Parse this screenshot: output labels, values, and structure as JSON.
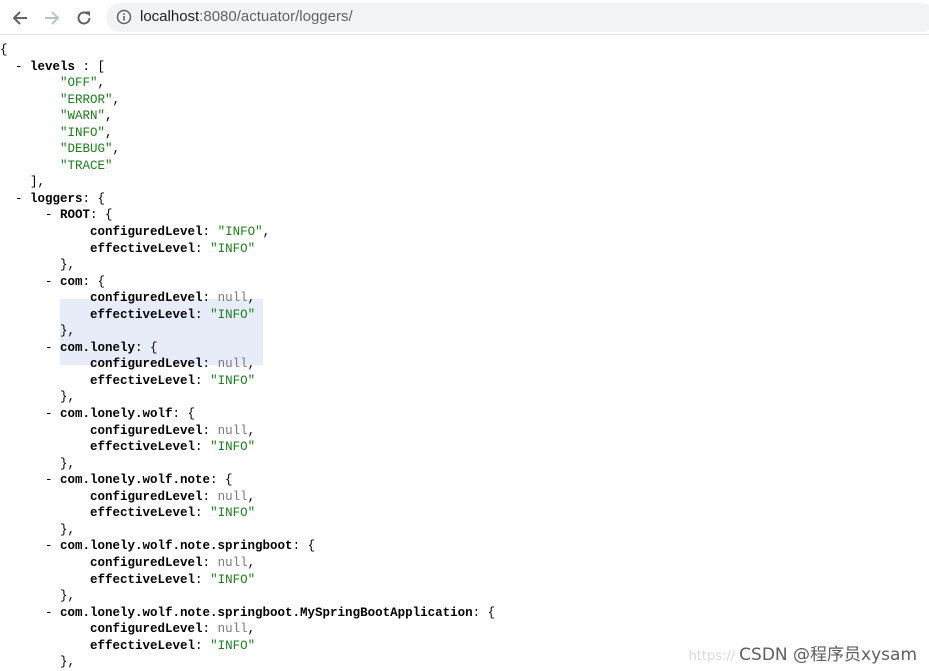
{
  "browser": {
    "url_host": "localhost",
    "url_path": ":8080/actuator/loggers/",
    "back_icon": "arrow-left-icon",
    "forward_icon": "arrow-right-icon",
    "reload_icon": "reload-icon",
    "site_info_icon": "info-icon"
  },
  "json": {
    "open_brace": "{",
    "levels_key": "levels",
    "levels_open": ": [",
    "levels": [
      "OFF",
      "ERROR",
      "WARN",
      "INFO",
      "DEBUG",
      "TRACE"
    ],
    "levels_close": "],",
    "loggers_key": "loggers",
    "loggers_open": ": {",
    "loggers": [
      {
        "name": "ROOT",
        "configuredLevel": "INFO",
        "effectiveLevel": "INFO"
      },
      {
        "name": "com",
        "configuredLevel": null,
        "effectiveLevel": "INFO"
      },
      {
        "name": "com.lonely",
        "configuredLevel": null,
        "effectiveLevel": "INFO"
      },
      {
        "name": "com.lonely.wolf",
        "configuredLevel": null,
        "effectiveLevel": "INFO"
      },
      {
        "name": "com.lonely.wolf.note",
        "configuredLevel": null,
        "effectiveLevel": "INFO"
      },
      {
        "name": "com.lonely.wolf.note.springboot",
        "configuredLevel": null,
        "effectiveLevel": "INFO"
      },
      {
        "name": "com.lonely.wolf.note.springboot.MySpringBootApplication",
        "configuredLevel": null,
        "effectiveLevel": "INFO"
      }
    ],
    "configured_key": "configuredLevel",
    "effective_key": "effectiveLevel",
    "null_text": "null"
  },
  "watermark": {
    "prefix": "https://",
    "text": "CSDN @程序员xysam"
  }
}
